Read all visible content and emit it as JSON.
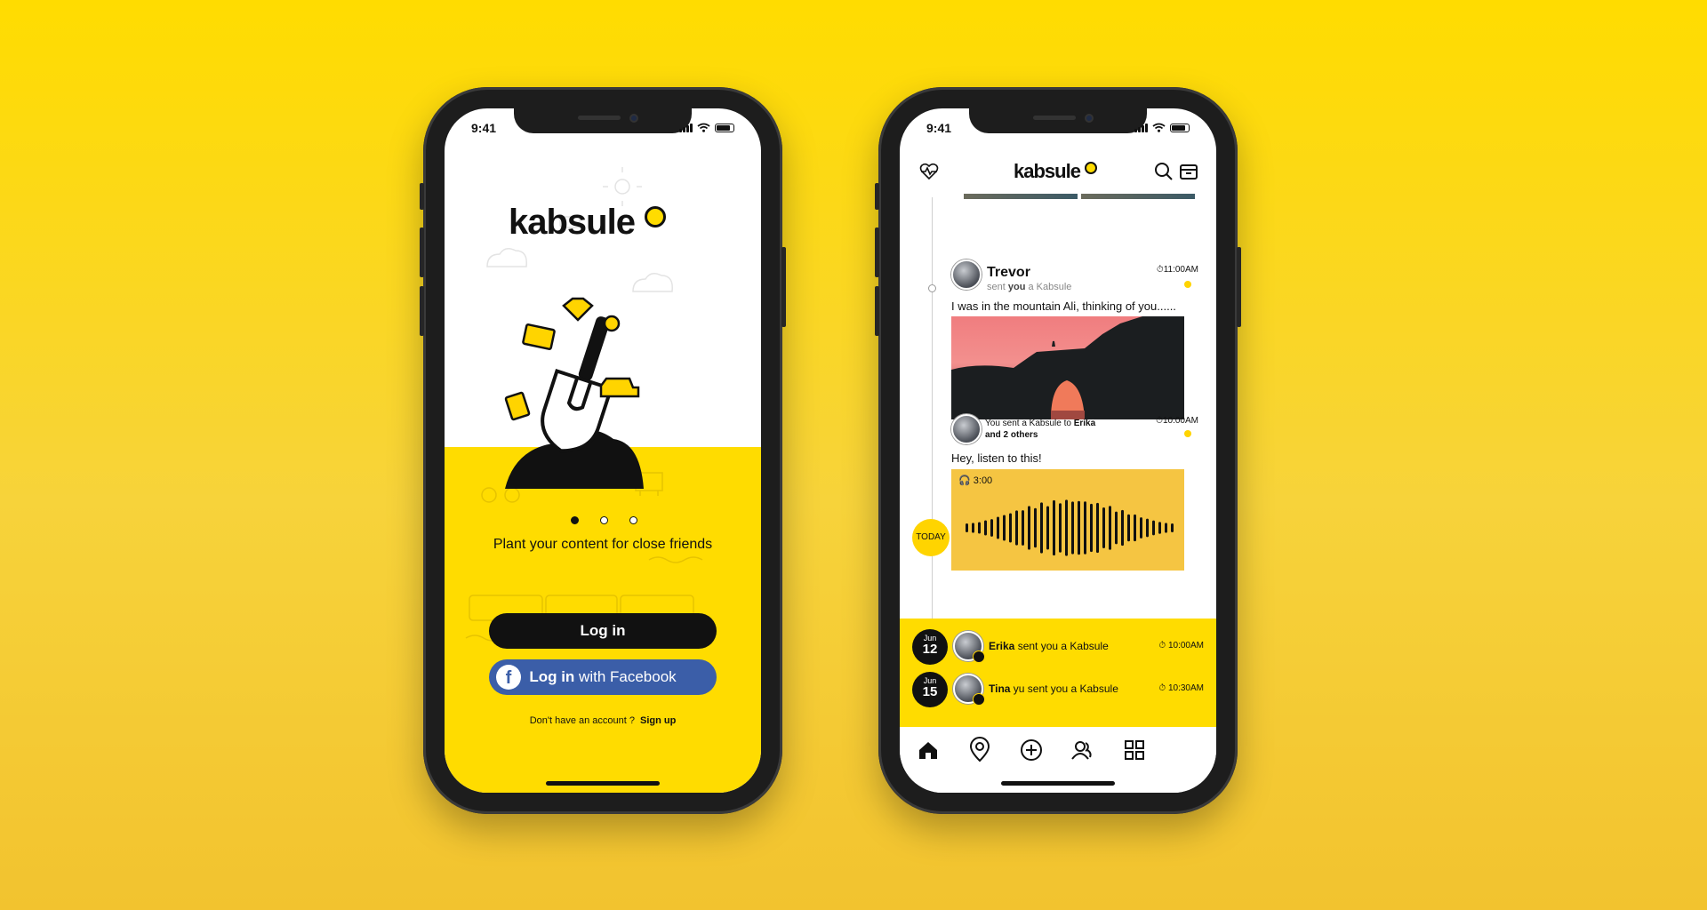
{
  "left_phone": {
    "status_time": "9:41",
    "logo_text": "kabsule",
    "carousel_dots": 3,
    "carousel_active": 1,
    "tagline": "Plant your content for close friends",
    "login_label": "Log in",
    "fb_login_strong": "Log in",
    "fb_login_rest": " with Facebook",
    "no_account_text": "Don't have an account ?",
    "signup_label": "Sign up"
  },
  "right_phone": {
    "status_time": "9:41",
    "logo_text": "kabsule",
    "post1": {
      "author": "Trevor",
      "subtitle_pre": "sent ",
      "subtitle_you": "you",
      "subtitle_post": " a Kabsule",
      "time": "11:00AM",
      "text": "I was in the mountain Ali, thinking of you......"
    },
    "post2": {
      "subtitle_pre": "You sent a Kabsule to ",
      "subtitle_name": "Erika",
      "subtitle_line2": "and 2 others",
      "time": "10:00AM",
      "text": "Hey, listen to this!",
      "audio_duration": "3:00"
    },
    "today_label": "TODAY",
    "notifications": [
      {
        "month": "Jun",
        "day": "12",
        "name": "Erika",
        "rest": " sent you a Kabsule",
        "time": "10:00AM"
      },
      {
        "month": "Jun",
        "day": "15",
        "name": "Tina",
        "rest": " yu sent you a Kabsule",
        "time": "10:30AM"
      }
    ],
    "tabs": [
      "home-icon",
      "location-icon",
      "add-icon",
      "friends-icon",
      "grid-icon"
    ]
  },
  "colors": {
    "brand_yellow": "#ffdc00",
    "facebook_blue": "#3b5ea8",
    "dark": "#111111"
  }
}
